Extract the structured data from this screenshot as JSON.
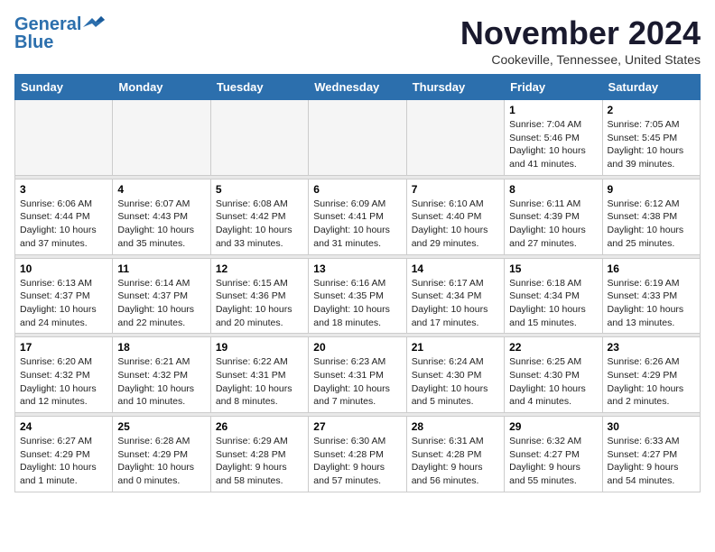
{
  "logo": {
    "line1": "General",
    "line2": "Blue"
  },
  "header": {
    "month": "November 2024",
    "location": "Cookeville, Tennessee, United States"
  },
  "weekdays": [
    "Sunday",
    "Monday",
    "Tuesday",
    "Wednesday",
    "Thursday",
    "Friday",
    "Saturday"
  ],
  "weeks": [
    [
      {
        "day": "",
        "info": ""
      },
      {
        "day": "",
        "info": ""
      },
      {
        "day": "",
        "info": ""
      },
      {
        "day": "",
        "info": ""
      },
      {
        "day": "",
        "info": ""
      },
      {
        "day": "1",
        "info": "Sunrise: 7:04 AM\nSunset: 5:46 PM\nDaylight: 10 hours\nand 41 minutes."
      },
      {
        "day": "2",
        "info": "Sunrise: 7:05 AM\nSunset: 5:45 PM\nDaylight: 10 hours\nand 39 minutes."
      }
    ],
    [
      {
        "day": "3",
        "info": "Sunrise: 6:06 AM\nSunset: 4:44 PM\nDaylight: 10 hours\nand 37 minutes."
      },
      {
        "day": "4",
        "info": "Sunrise: 6:07 AM\nSunset: 4:43 PM\nDaylight: 10 hours\nand 35 minutes."
      },
      {
        "day": "5",
        "info": "Sunrise: 6:08 AM\nSunset: 4:42 PM\nDaylight: 10 hours\nand 33 minutes."
      },
      {
        "day": "6",
        "info": "Sunrise: 6:09 AM\nSunset: 4:41 PM\nDaylight: 10 hours\nand 31 minutes."
      },
      {
        "day": "7",
        "info": "Sunrise: 6:10 AM\nSunset: 4:40 PM\nDaylight: 10 hours\nand 29 minutes."
      },
      {
        "day": "8",
        "info": "Sunrise: 6:11 AM\nSunset: 4:39 PM\nDaylight: 10 hours\nand 27 minutes."
      },
      {
        "day": "9",
        "info": "Sunrise: 6:12 AM\nSunset: 4:38 PM\nDaylight: 10 hours\nand 25 minutes."
      }
    ],
    [
      {
        "day": "10",
        "info": "Sunrise: 6:13 AM\nSunset: 4:37 PM\nDaylight: 10 hours\nand 24 minutes."
      },
      {
        "day": "11",
        "info": "Sunrise: 6:14 AM\nSunset: 4:37 PM\nDaylight: 10 hours\nand 22 minutes."
      },
      {
        "day": "12",
        "info": "Sunrise: 6:15 AM\nSunset: 4:36 PM\nDaylight: 10 hours\nand 20 minutes."
      },
      {
        "day": "13",
        "info": "Sunrise: 6:16 AM\nSunset: 4:35 PM\nDaylight: 10 hours\nand 18 minutes."
      },
      {
        "day": "14",
        "info": "Sunrise: 6:17 AM\nSunset: 4:34 PM\nDaylight: 10 hours\nand 17 minutes."
      },
      {
        "day": "15",
        "info": "Sunrise: 6:18 AM\nSunset: 4:34 PM\nDaylight: 10 hours\nand 15 minutes."
      },
      {
        "day": "16",
        "info": "Sunrise: 6:19 AM\nSunset: 4:33 PM\nDaylight: 10 hours\nand 13 minutes."
      }
    ],
    [
      {
        "day": "17",
        "info": "Sunrise: 6:20 AM\nSunset: 4:32 PM\nDaylight: 10 hours\nand 12 minutes."
      },
      {
        "day": "18",
        "info": "Sunrise: 6:21 AM\nSunset: 4:32 PM\nDaylight: 10 hours\nand 10 minutes."
      },
      {
        "day": "19",
        "info": "Sunrise: 6:22 AM\nSunset: 4:31 PM\nDaylight: 10 hours\nand 8 minutes."
      },
      {
        "day": "20",
        "info": "Sunrise: 6:23 AM\nSunset: 4:31 PM\nDaylight: 10 hours\nand 7 minutes."
      },
      {
        "day": "21",
        "info": "Sunrise: 6:24 AM\nSunset: 4:30 PM\nDaylight: 10 hours\nand 5 minutes."
      },
      {
        "day": "22",
        "info": "Sunrise: 6:25 AM\nSunset: 4:30 PM\nDaylight: 10 hours\nand 4 minutes."
      },
      {
        "day": "23",
        "info": "Sunrise: 6:26 AM\nSunset: 4:29 PM\nDaylight: 10 hours\nand 2 minutes."
      }
    ],
    [
      {
        "day": "24",
        "info": "Sunrise: 6:27 AM\nSunset: 4:29 PM\nDaylight: 10 hours\nand 1 minute."
      },
      {
        "day": "25",
        "info": "Sunrise: 6:28 AM\nSunset: 4:29 PM\nDaylight: 10 hours\nand 0 minutes."
      },
      {
        "day": "26",
        "info": "Sunrise: 6:29 AM\nSunset: 4:28 PM\nDaylight: 9 hours\nand 58 minutes."
      },
      {
        "day": "27",
        "info": "Sunrise: 6:30 AM\nSunset: 4:28 PM\nDaylight: 9 hours\nand 57 minutes."
      },
      {
        "day": "28",
        "info": "Sunrise: 6:31 AM\nSunset: 4:28 PM\nDaylight: 9 hours\nand 56 minutes."
      },
      {
        "day": "29",
        "info": "Sunrise: 6:32 AM\nSunset: 4:27 PM\nDaylight: 9 hours\nand 55 minutes."
      },
      {
        "day": "30",
        "info": "Sunrise: 6:33 AM\nSunset: 4:27 PM\nDaylight: 9 hours\nand 54 minutes."
      }
    ]
  ]
}
